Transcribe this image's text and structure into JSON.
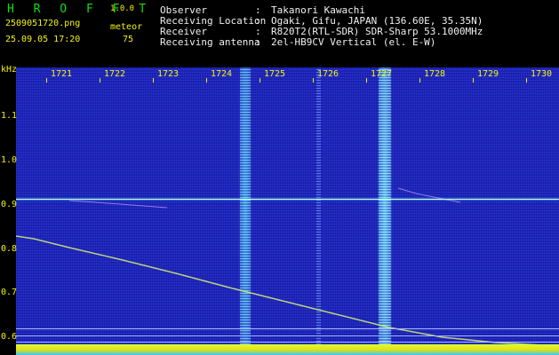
{
  "header": {
    "app_logo": "H R O F F T",
    "version": "1.0.0",
    "filename": "2509051720.png",
    "meteor_label": "meteor",
    "datetime": "25.09.05 17:20",
    "meteor_count": "75"
  },
  "info": [
    {
      "label": "Observer",
      "value": "Takanori Kawachi"
    },
    {
      "label": "Receiving Location",
      "value": "Ogaki, Gifu, JAPAN (136.60E, 35.35N)"
    },
    {
      "label": "Receiver",
      "value": "R820T2(RTL-SDR) SDR-Sharp 53.1000MHz"
    },
    {
      "label": "Receiving antenna",
      "value": "2el-HB9CV Vertical (el. E-W)"
    }
  ],
  "separator": ":",
  "axis": {
    "units_label": "kHz",
    "time_ticks": [
      "1721",
      "1722",
      "1723",
      "1724",
      "1725",
      "1726",
      "1727",
      "1728",
      "1729",
      "1730"
    ],
    "freq_ticks": [
      "1.1",
      "1.0",
      "0.9",
      "0.8",
      "0.7",
      "0.6"
    ]
  },
  "colors": {
    "text_yellow": "#f4f410",
    "logo_green": "#12e012",
    "label_white": "#f0f0f0",
    "waterfall_bg": "#1a1ca8",
    "carrier": "#c8fcff"
  }
}
